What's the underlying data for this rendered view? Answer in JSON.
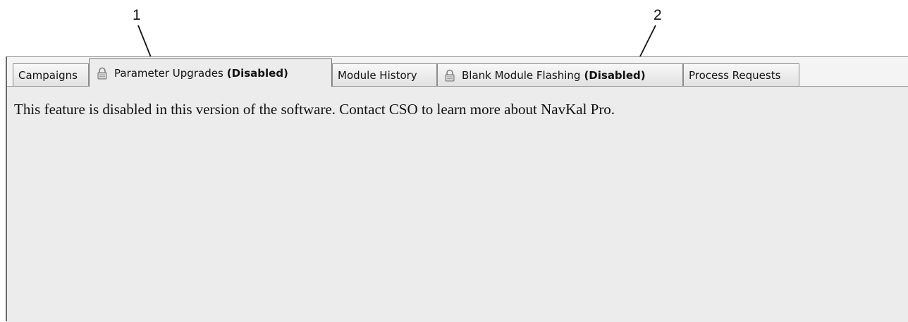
{
  "callouts": [
    "1",
    "2"
  ],
  "tabs": [
    {
      "label": "Campaigns",
      "suffix": "",
      "icon": "",
      "selected": false
    },
    {
      "label": "Parameter Upgrades",
      "suffix": "(Disabled)",
      "icon": "lock-icon",
      "selected": true
    },
    {
      "label": "Module History",
      "suffix": "",
      "icon": "",
      "selected": false
    },
    {
      "label": "Blank Module Flashing",
      "suffix": "(Disabled)",
      "icon": "lock-icon",
      "selected": false
    },
    {
      "label": "Process Requests",
      "suffix": "",
      "icon": "",
      "selected": false
    }
  ],
  "content": {
    "message": "This feature is disabled in this version of the software. Contact CSO to learn more about NavKal Pro."
  },
  "colors": {
    "panel_background": "#ececec",
    "tab_border": "#8d8d8d",
    "text": "#111111"
  }
}
